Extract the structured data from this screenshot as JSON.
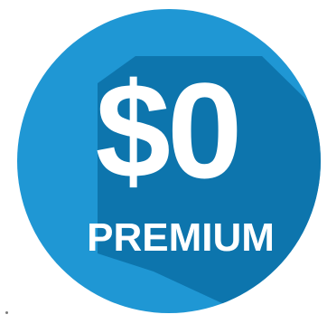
{
  "badge": {
    "amount": "$0",
    "label": "PREMIUM",
    "colors": {
      "circle": "#1f97d4",
      "long_shadow": "#0a6fa6",
      "text": "#ffffff"
    }
  }
}
